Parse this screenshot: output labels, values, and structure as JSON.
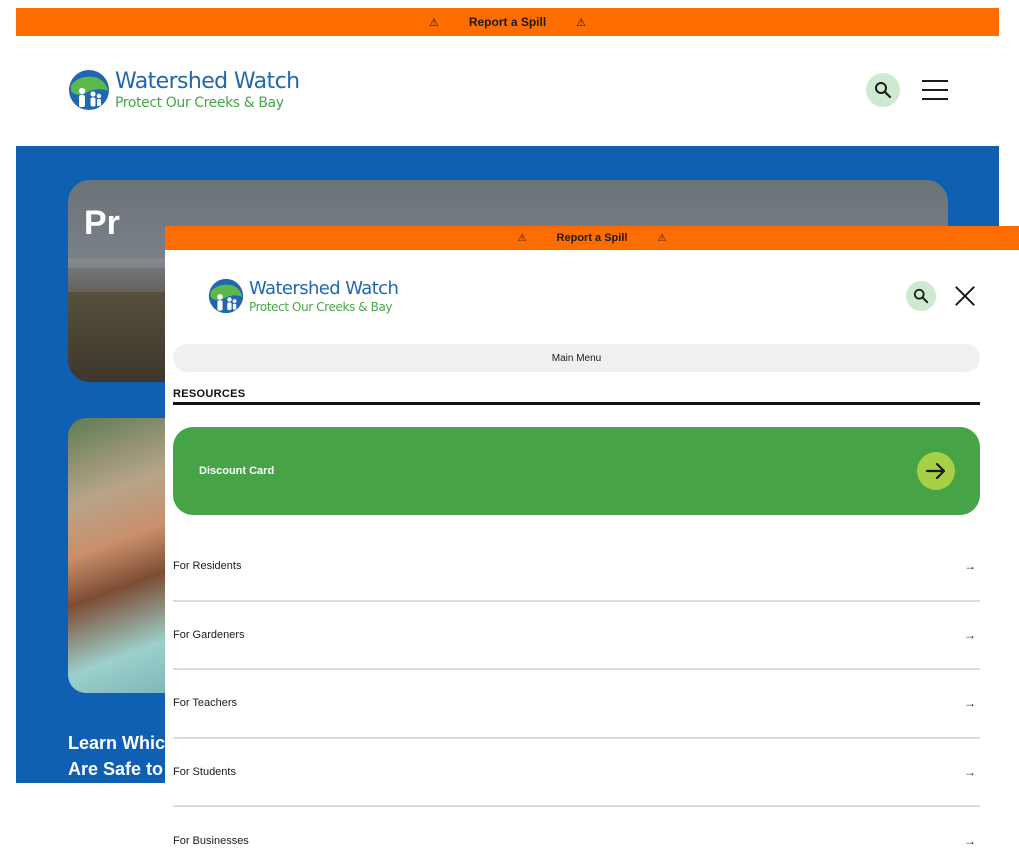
{
  "top_banner": {
    "label": "Report a Spill",
    "icon_left": "warning-icon",
    "icon_right": "warning-icon",
    "glyph": "⚠"
  },
  "header": {
    "logo": {
      "title": "Watershed Watch",
      "subtitle": "Protect Our Creeks & Bay"
    }
  },
  "hero": {
    "title": "Pr"
  },
  "feature": {
    "heading": "Learn Whic\nAre Safe to"
  },
  "menu": {
    "banner": {
      "label": "Report a Spill",
      "glyph": "⚠"
    },
    "logo": {
      "title": "Watershed Watch",
      "subtitle": "Protect Our Creeks & Bay"
    },
    "main_menu_label": "Main Menu",
    "section_title": "RESOURCES",
    "promo": {
      "label": "Discount Card"
    },
    "arrow_glyph": "→",
    "items": [
      {
        "label": "For Residents"
      },
      {
        "label": "For Gardeners"
      },
      {
        "label": "For Teachers"
      },
      {
        "label": "For Students"
      },
      {
        "label": "For Businesses"
      }
    ]
  },
  "colors": {
    "orange": "#ff6c00",
    "blue": "#0f5fb3",
    "green": "#46a447",
    "lime": "#a6d146",
    "logo_blue": "#1f67b1",
    "logo_green": "#46a648"
  }
}
